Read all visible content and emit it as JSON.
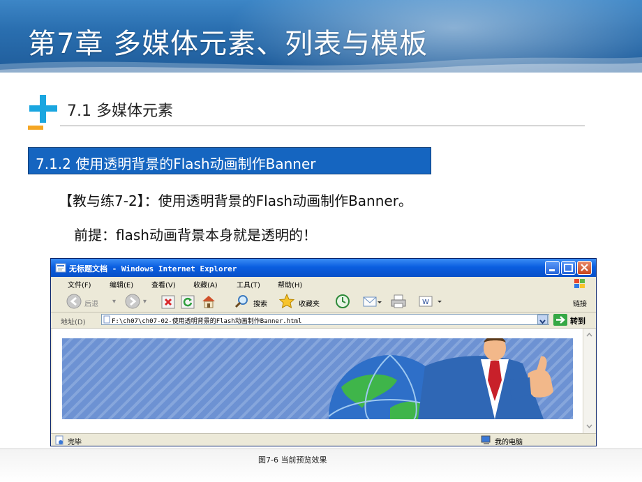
{
  "slide": {
    "title": "第7章  多媒体元素、列表与模板",
    "section": "7.1  多媒体元素",
    "subsection": "7.1.2  使用透明背景的Flash动画制作Banner",
    "body_line1": "【教与练7-2】：使用透明背景的Flash动画制作Banner。",
    "body_line2": "前提：flash动画背景本身就是透明的！",
    "caption": "图7-6  当前预览效果"
  },
  "browser": {
    "window_title": "无标题文档 - Windows Internet Explorer",
    "menu": [
      "文件(F)",
      "编辑(E)",
      "查看(V)",
      "收藏(A)",
      "工具(T)",
      "帮助(H)"
    ],
    "toolbar": {
      "back": "后退",
      "search": "搜索",
      "favorites": "收藏夹",
      "links": "链接"
    },
    "address": {
      "label": "地址(D)",
      "value": "F:\\ch07\\ch07-02-使用透明背景的Flash动画制作Banner.html",
      "go": "转到"
    },
    "status": {
      "text": "完毕",
      "zone": "我的电脑"
    }
  },
  "colors": {
    "header_blue": "#2a6fb0",
    "subsection_blue": "#1565c0",
    "plus_cyan": "#1aa6e0",
    "plus_orange": "#f5a623",
    "xp_title_blue": "#0a5ee0"
  }
}
